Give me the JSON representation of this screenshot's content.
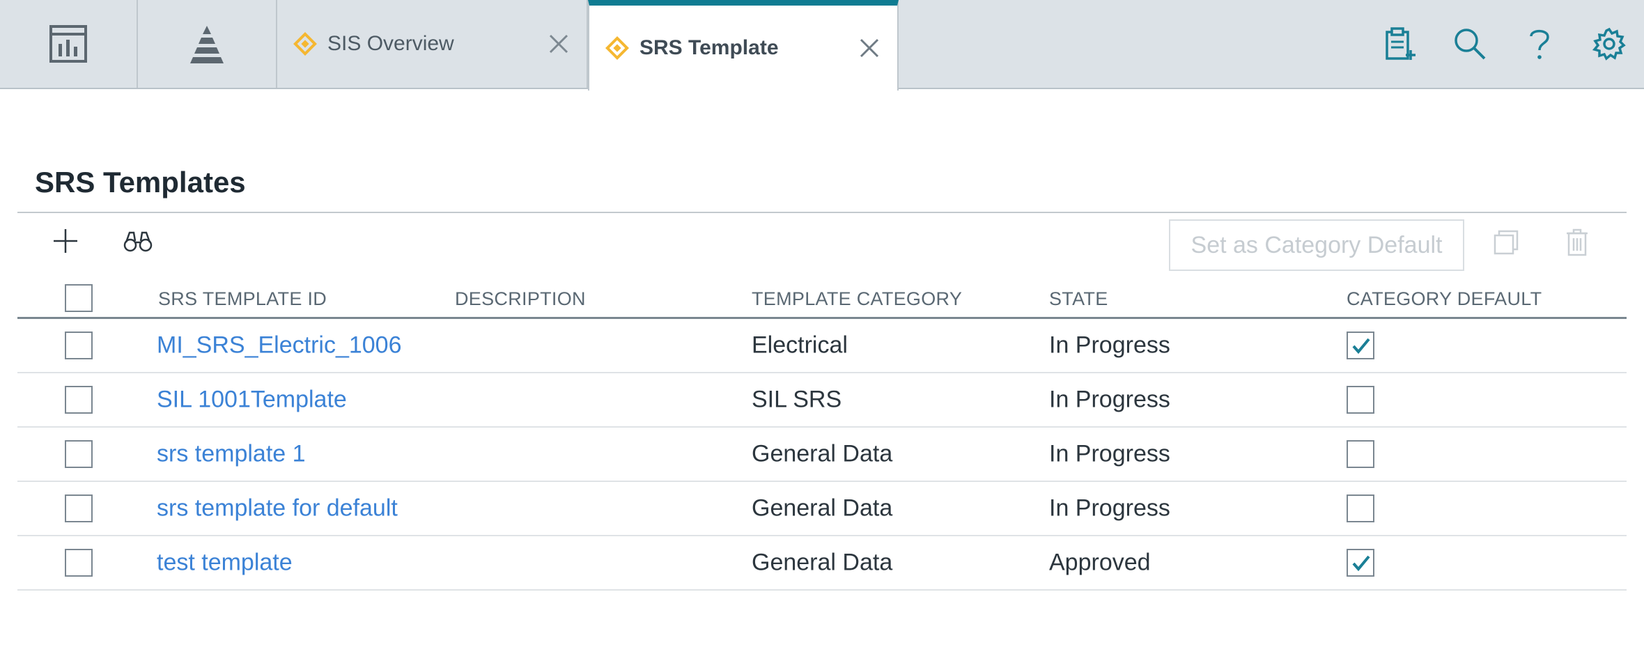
{
  "tabs": {
    "overview": {
      "label": "SIS Overview"
    },
    "active": {
      "label": "SRS Template"
    }
  },
  "page": {
    "title": "SRS Templates"
  },
  "toolbar": {
    "category_default_label": "Set as Category Default"
  },
  "colors": {
    "accent": "#0f7c92",
    "link": "#3b82d6",
    "diamond": "#f5b731"
  },
  "table": {
    "headers": [
      "SRS TEMPLATE ID",
      "DESCRIPTION",
      "TEMPLATE CATEGORY",
      "STATE",
      "CATEGORY DEFAULT"
    ],
    "rows": [
      {
        "id": "MI_SRS_Electric_1006",
        "description": "",
        "category": "Electrical",
        "state": "In Progress",
        "category_default": true
      },
      {
        "id": "SIL 1001Template",
        "description": "",
        "category": "SIL SRS",
        "state": "In Progress",
        "category_default": false
      },
      {
        "id": "srs template 1",
        "description": "",
        "category": "General Data",
        "state": "In Progress",
        "category_default": false
      },
      {
        "id": "srs template for default",
        "description": "",
        "category": "General Data",
        "state": "In Progress",
        "category_default": false
      },
      {
        "id": "test template",
        "description": "",
        "category": "General Data",
        "state": "Approved",
        "category_default": true
      }
    ]
  }
}
